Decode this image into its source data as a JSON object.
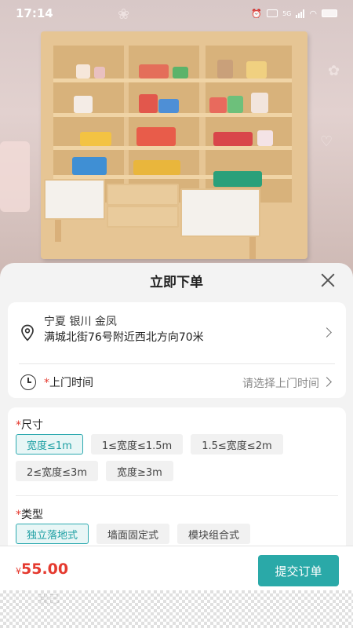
{
  "status_bar": {
    "time": "17:14",
    "network": "5G"
  },
  "sheet": {
    "title": "立即下单"
  },
  "address": {
    "region": "宁夏 银川 金凤",
    "street": "满城北街76号附近西北方向70米"
  },
  "service_time": {
    "required_mark": "*",
    "label": "上门时间",
    "placeholder": "请选择上门时间"
  },
  "options": {
    "size": {
      "required_mark": "*",
      "title": "尺寸",
      "items": [
        "宽度≤1m",
        "1≤宽度≤1.5m",
        "1.5≤宽度≤2m",
        "2≤宽度≤3m",
        "宽度≥3m"
      ],
      "selected": "宽度≤1m"
    },
    "type": {
      "required_mark": "*",
      "title": "类型",
      "items": [
        "独立落地式",
        "墙面固定式",
        "模块组合式"
      ],
      "selected": "独立落地式"
    }
  },
  "footer": {
    "currency": "¥",
    "price": "55.00",
    "submit_label": "提交订单",
    "agree_text": "我已"
  },
  "colors": {
    "accent": "#2aa9a8",
    "price": "#e53a2f"
  },
  "icons": [
    "close-icon",
    "location-pin-icon",
    "chevron-right-icon",
    "clock-icon",
    "radio-unchecked-icon"
  ]
}
